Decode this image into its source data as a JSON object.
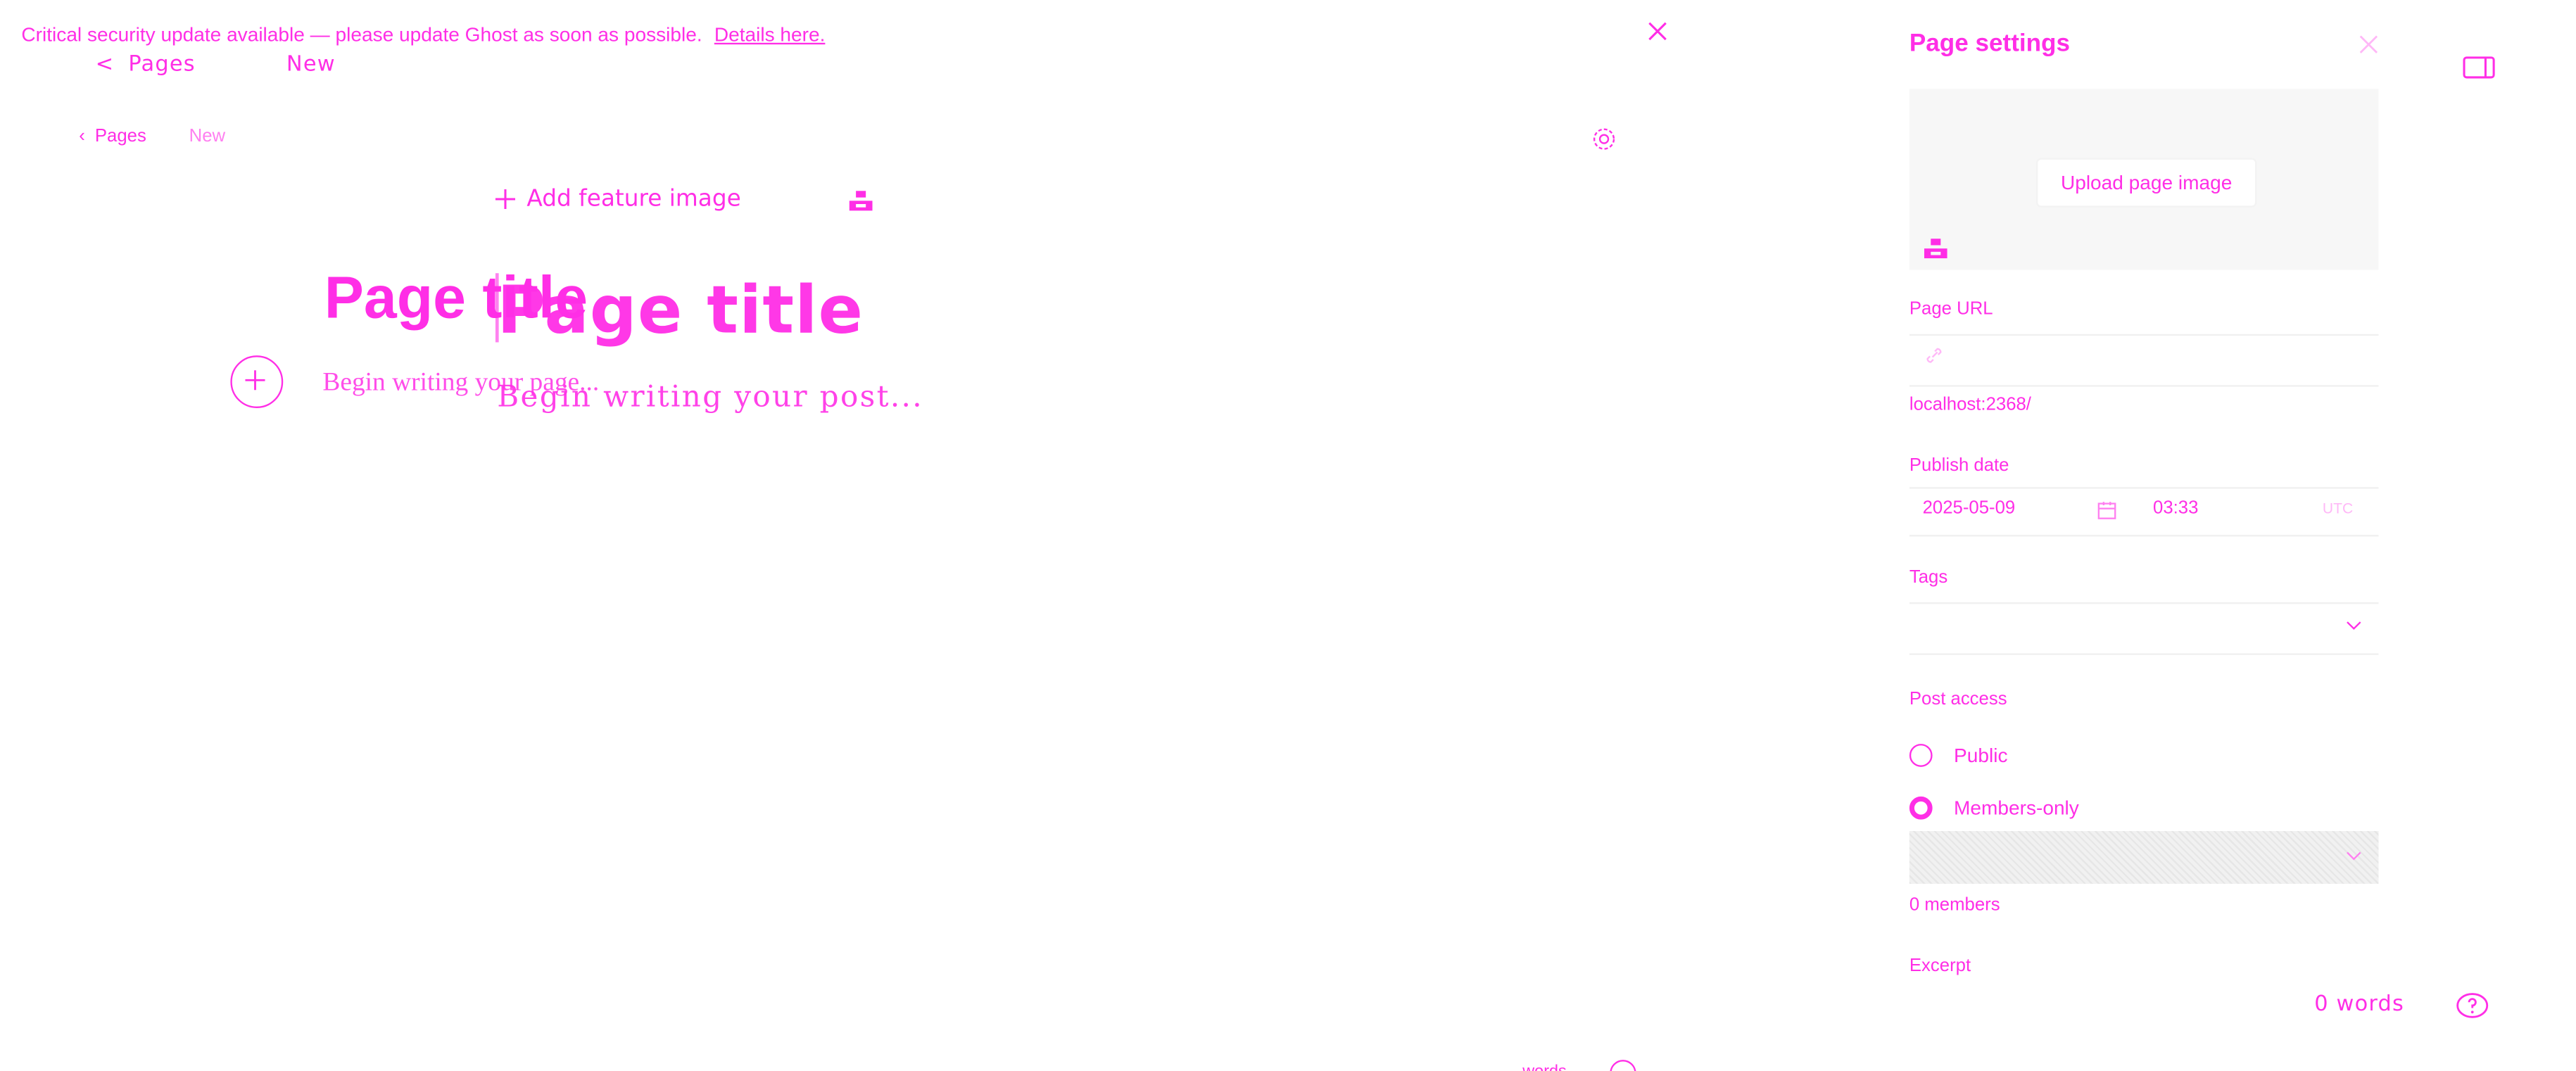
{
  "banner": {
    "message": "Critical security update available — please update Ghost as soon as possible.",
    "link_text": "Details here."
  },
  "topnav": {
    "back_glyph": "<",
    "pages": "Pages",
    "new": "New"
  },
  "breadcrumb": {
    "back_glyph": "‹",
    "pages": "Pages",
    "new": "New"
  },
  "editor": {
    "add_feature_image": "Add feature image",
    "title_placeholder_a": "Page title",
    "title_placeholder_b": "Page title",
    "body_placeholder_a": "Begin writing your page...",
    "body_placeholder_b": "Begin writing your post...",
    "word_count_small": "words"
  },
  "settings": {
    "title": "Page settings",
    "upload_image": "Upload page image",
    "page_url_label": "Page URL",
    "page_url_hint": "localhost:2368/",
    "publish_date_label": "Publish date",
    "publish_date": "2025-05-09",
    "publish_time": "03:33",
    "timezone": "UTC",
    "tags_label": "Tags",
    "post_access_label": "Post access",
    "access_options": [
      {
        "label": "Public",
        "checked": false
      },
      {
        "label": "Members-only",
        "checked": true
      }
    ],
    "members_count": "0 members",
    "excerpt_label": "Excerpt"
  },
  "footer": {
    "word_count": "0 words"
  },
  "colors": {
    "accent": "#ff2ee6",
    "panel_bg": "#f7f7f7"
  },
  "icons": [
    "close-icon",
    "gear-icon",
    "plus-icon",
    "unsplash-icon",
    "link-icon",
    "calendar-icon",
    "chevron-down-icon",
    "help-icon",
    "sidebar-toggle-icon"
  ]
}
